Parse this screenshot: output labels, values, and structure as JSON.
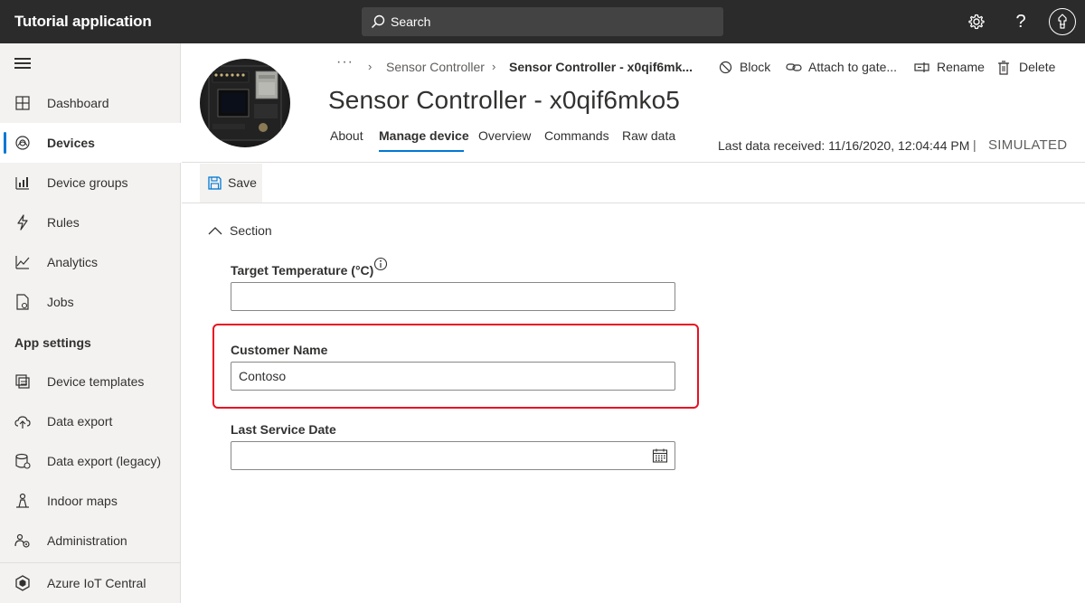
{
  "app": {
    "title": "Tutorial application"
  },
  "search": {
    "placeholder": "Search"
  },
  "sidebar": {
    "items": [
      {
        "label": "Dashboard"
      },
      {
        "label": "Devices"
      },
      {
        "label": "Device groups"
      },
      {
        "label": "Rules"
      },
      {
        "label": "Analytics"
      },
      {
        "label": "Jobs"
      }
    ],
    "section_label": "App settings",
    "settings_items": [
      {
        "label": "Device templates"
      },
      {
        "label": "Data export"
      },
      {
        "label": "Data export (legacy)"
      },
      {
        "label": "Indoor maps"
      },
      {
        "label": "Administration"
      }
    ],
    "footer": {
      "label": "Azure IoT Central"
    }
  },
  "breadcrumb": {
    "more": "···",
    "parent": "Sensor Controller",
    "current": "Sensor Controller - x0qif6mk..."
  },
  "commands": {
    "block": "Block",
    "attach": "Attach to gate...",
    "rename": "Rename",
    "delete": "Delete"
  },
  "device": {
    "title": "Sensor Controller - x0qif6mko5"
  },
  "tabs": [
    {
      "label": "About"
    },
    {
      "label": "Manage device"
    },
    {
      "label": "Overview"
    },
    {
      "label": "Commands"
    },
    {
      "label": "Raw data"
    }
  ],
  "status": {
    "last_data": "Last data received: 11/16/2020, 12:04:44 PM",
    "separator": "|",
    "simulated": "SIMULATED"
  },
  "toolbar": {
    "save_label": "Save"
  },
  "form": {
    "section_label": "Section",
    "fields": [
      {
        "label": "Target Temperature (°C)",
        "value": ""
      },
      {
        "label": "Customer Name",
        "value": "Contoso"
      },
      {
        "label": "Last Service Date",
        "value": ""
      }
    ]
  },
  "colors": {
    "accent": "#0078d4",
    "highlight": "#e81123",
    "topbar": "#2b2b2b"
  }
}
